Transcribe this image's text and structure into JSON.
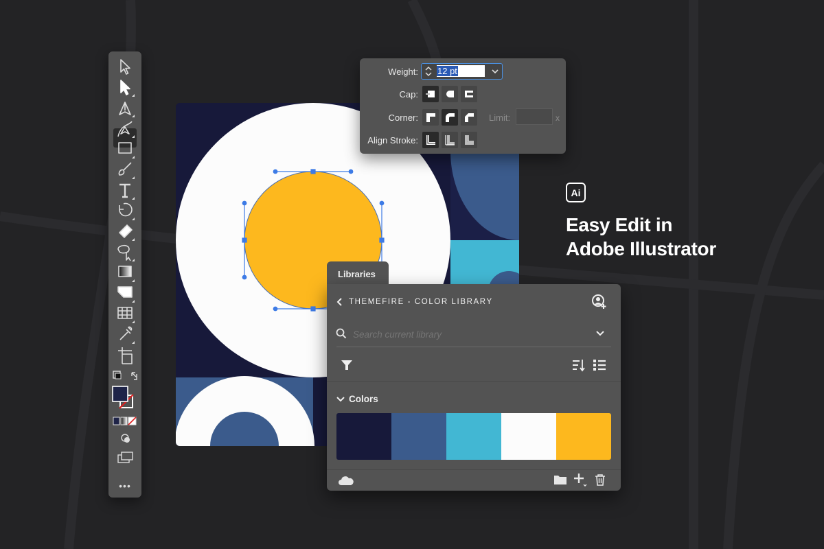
{
  "toolbar": {
    "tools": [
      "selection-tool",
      "direct-selection-tool",
      "pen-tool",
      "curvature-tool",
      "rectangle-tool",
      "paintbrush-tool",
      "type-tool",
      "rotate-tool",
      "eraser-tool",
      "puppet-warp-tool",
      "gradient-tool",
      "shape-builder-tool",
      "mesh-tool",
      "eyedropper-tool",
      "artboard-tool"
    ],
    "more_label": "•••",
    "fill_color": "#1f2448",
    "stroke_color": "none"
  },
  "stroke_panel": {
    "weight_label": "Weight:",
    "weight_value": "12 pt",
    "cap_label": "Cap:",
    "corner_label": "Corner:",
    "limit_label": "Limit:",
    "limit_unit": "x",
    "align_label": "Align Stroke:"
  },
  "libraries": {
    "tab_label": "Libraries",
    "back_icon": "chevron-left-icon",
    "library_name": "THEMEFIRE - COLOR LIBRARY",
    "search_placeholder": "Search current library",
    "section_label": "Colors",
    "swatches": [
      "#17193a",
      "#3b5b8c",
      "#42b7d3",
      "#fcfcfc",
      "#fdb81e"
    ]
  },
  "brand": {
    "logo_text": "Ai",
    "title_line1": "Easy Edit in",
    "title_line2": "Adobe Illustrator"
  },
  "colors": {
    "background": "#232325",
    "panel": "#535353",
    "selection_blue": "#3d7be6",
    "artboard_navy": "#17193a",
    "accent_yellow": "#fdb81e"
  }
}
